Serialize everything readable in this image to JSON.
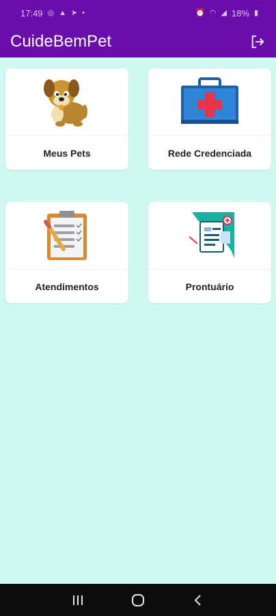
{
  "status_bar": {
    "time": "17:49",
    "battery": "18%"
  },
  "app_bar": {
    "title": "CuideBemPet"
  },
  "cards": [
    {
      "label": "Meus Pets",
      "icon": "dog-icon"
    },
    {
      "label": "Rede Credenciada",
      "icon": "medical-kit-icon"
    },
    {
      "label": "Atendimentos",
      "icon": "clipboard-checklist-icon"
    },
    {
      "label": "Prontuário",
      "icon": "medical-record-icon"
    }
  ],
  "colors": {
    "primary": "#6a0dad",
    "background": "#cff8f1",
    "card": "#ffffff"
  }
}
